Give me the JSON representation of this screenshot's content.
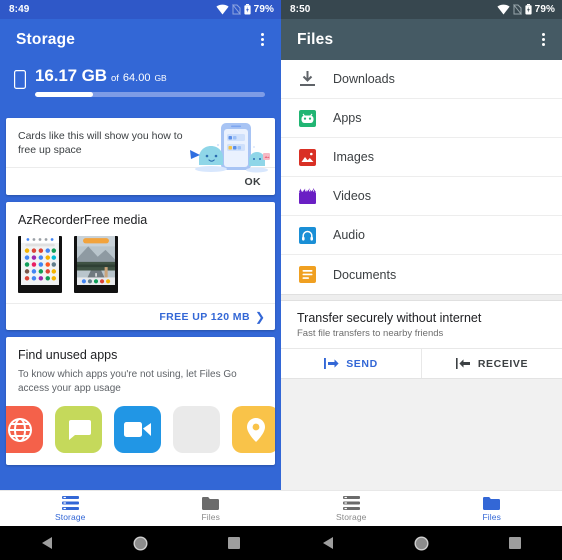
{
  "left_phone": {
    "status_bar": {
      "time": "8:49",
      "battery_percent": "79%",
      "icons": [
        "wifi-icon",
        "sim-off-icon",
        "battery-icon"
      ]
    },
    "app_bar": {
      "title": "Storage",
      "overflow_icon": "kebab-menu-icon"
    },
    "storage_summary": {
      "device_icon": "phone-icon",
      "used": "16.17 GB",
      "of_label": "of",
      "total": "64.00",
      "total_unit": "GB",
      "progress_percent": 25
    },
    "cards": {
      "promo": {
        "text": "Cards like this will show you how to free up space",
        "action_label": "OK",
        "illustration": "phone-with-mascots-illustration"
      },
      "media": {
        "title": "AzRecorderFree media",
        "thumbnails": [
          "app-drawer-screenshot",
          "mountain-road-screenshot"
        ],
        "action_label": "FREE UP 120 MB",
        "action_icon": "chevron-right-icon"
      },
      "unused_apps": {
        "title": "Find unused apps",
        "description": "To know which apps you're not using, let Files Go access your app usage",
        "app_icons": [
          {
            "name": "browser-app-icon",
            "color": "#f4614a"
          },
          {
            "name": "messages-app-icon",
            "color": "#c5d95b"
          },
          {
            "name": "video-app-icon",
            "color": "#2196e5"
          },
          {
            "name": "blank-app-icon",
            "color": "#eaeaea"
          },
          {
            "name": "location-app-icon",
            "color": "#f9c349"
          }
        ]
      }
    },
    "bottom_nav": [
      {
        "label": "Storage",
        "icon": "storage-list-icon",
        "active": true
      },
      {
        "label": "Files",
        "icon": "folder-icon",
        "active": false
      }
    ]
  },
  "right_phone": {
    "status_bar": {
      "time": "8:50",
      "battery_percent": "79%",
      "icons": [
        "wifi-icon",
        "sim-off-icon",
        "battery-icon"
      ]
    },
    "app_bar": {
      "title": "Files",
      "overflow_icon": "kebab-menu-icon"
    },
    "file_categories": [
      {
        "label": "Downloads",
        "icon": "download-icon",
        "color": "#5f6368"
      },
      {
        "label": "Apps",
        "icon": "android-apps-icon",
        "color": "#21b573"
      },
      {
        "label": "Images",
        "icon": "image-icon",
        "color": "#d93025"
      },
      {
        "label": "Videos",
        "icon": "video-clapper-icon",
        "color": "#6a1fc4"
      },
      {
        "label": "Audio",
        "icon": "headphones-icon",
        "color": "#1a8fd6"
      },
      {
        "label": "Documents",
        "icon": "document-lines-icon",
        "color": "#f0a021"
      }
    ],
    "transfer": {
      "title": "Transfer securely without internet",
      "subtitle": "Fast file transfers to nearby friends",
      "send_label": "SEND",
      "send_icon": "send-arrow-icon",
      "receive_label": "RECEIVE",
      "receive_icon": "receive-arrow-icon"
    },
    "bottom_nav": [
      {
        "label": "Storage",
        "icon": "storage-list-icon",
        "active": false
      },
      {
        "label": "Files",
        "icon": "folder-icon",
        "active": true
      }
    ]
  },
  "system_nav": {
    "back": "back-triangle-icon",
    "home": "home-circle-icon",
    "recents": "recents-square-icon"
  },
  "colors": {
    "blue_primary": "#3367d6",
    "blue_status": "#2f58c8",
    "dark_appbar": "#455a64",
    "dark_status": "#37474f"
  }
}
